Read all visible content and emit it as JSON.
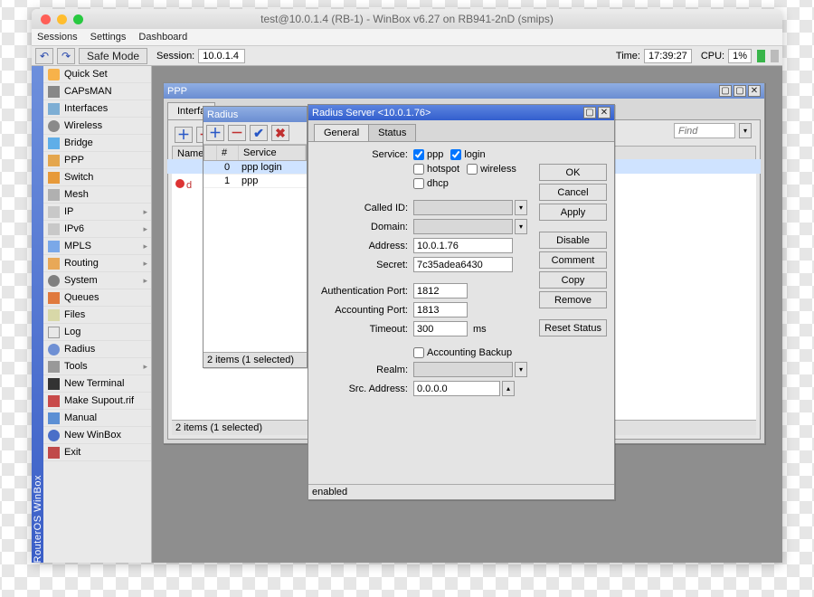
{
  "window_title": "test@10.0.1.4 (RB-1) - WinBox v6.27 on RB941-2nD (smips)",
  "menubar": {
    "sessions": "Sessions",
    "settings": "Settings",
    "dashboard": "Dashboard"
  },
  "toolbar": {
    "safe_mode": "Safe Mode",
    "session_label": "Session:",
    "session_value": "10.0.1.4",
    "time_label": "Time:",
    "time_value": "17:39:27",
    "cpu_label": "CPU:",
    "cpu_value": "1%"
  },
  "vstrip": "RouterOS WinBox",
  "nav": [
    {
      "label": "Quick Set",
      "cls": "ico-qs"
    },
    {
      "label": "CAPsMAN",
      "cls": "ico-cap"
    },
    {
      "label": "Interfaces",
      "cls": "ico-if"
    },
    {
      "label": "Wireless",
      "cls": "ico-wl"
    },
    {
      "label": "Bridge",
      "cls": "ico-br"
    },
    {
      "label": "PPP",
      "cls": "ico-ppp"
    },
    {
      "label": "Switch",
      "cls": "ico-sw"
    },
    {
      "label": "Mesh",
      "cls": "ico-mesh"
    },
    {
      "label": "IP",
      "cls": "ico-ip",
      "sub": true
    },
    {
      "label": "IPv6",
      "cls": "ico-ip",
      "sub": true
    },
    {
      "label": "MPLS",
      "cls": "ico-mpls",
      "sub": true
    },
    {
      "label": "Routing",
      "cls": "ico-rt",
      "sub": true
    },
    {
      "label": "System",
      "cls": "ico-sys",
      "sub": true
    },
    {
      "label": "Queues",
      "cls": "ico-q"
    },
    {
      "label": "Files",
      "cls": "ico-files"
    },
    {
      "label": "Log",
      "cls": "ico-log"
    },
    {
      "label": "Radius",
      "cls": "ico-rad"
    },
    {
      "label": "Tools",
      "cls": "ico-tools",
      "sub": true
    },
    {
      "label": "New Terminal",
      "cls": "ico-term"
    },
    {
      "label": "Make Supout.rif",
      "cls": "ico-sup"
    },
    {
      "label": "Manual",
      "cls": "ico-man"
    },
    {
      "label": "New WinBox",
      "cls": "ico-new"
    },
    {
      "label": "Exit",
      "cls": "ico-exit"
    }
  ],
  "ppp_window": {
    "title": "PPP",
    "tabs_first": "Interfa",
    "status": "2 items (1 selected)",
    "col_name": "Name",
    "find_placeholder": "Find"
  },
  "radius_window": {
    "title": "Radius",
    "cols": {
      "num": "#",
      "service": "Service"
    },
    "rows": [
      {
        "idx": "0",
        "service": "ppp login",
        "sel": true
      },
      {
        "idx": "1",
        "service": "ppp",
        "sel": false
      }
    ],
    "status": "2 items (1 selected)"
  },
  "radius_server": {
    "title": "Radius Server <10.0.1.76>",
    "tabs": {
      "general": "General",
      "status": "Status"
    },
    "labels": {
      "service": "Service:",
      "called_id": "Called ID:",
      "domain": "Domain:",
      "address": "Address:",
      "secret": "Secret:",
      "auth_port": "Authentication Port:",
      "acct_port": "Accounting Port:",
      "timeout": "Timeout:",
      "acct_backup": "Accounting Backup",
      "realm": "Realm:",
      "src_address": "Src. Address:",
      "ms": "ms"
    },
    "services": {
      "ppp": "ppp",
      "login": "login",
      "hotspot": "hotspot",
      "wireless": "wireless",
      "dhcp": "dhcp"
    },
    "values": {
      "ppp": true,
      "login": true,
      "hotspot": false,
      "wireless": false,
      "dhcp": false,
      "address": "10.0.1.76",
      "secret": "7c35adea6430",
      "auth_port": "1812",
      "acct_port": "1813",
      "timeout": "300",
      "acct_backup": false,
      "src_address": "0.0.0.0"
    },
    "buttons": {
      "ok": "OK",
      "cancel": "Cancel",
      "apply": "Apply",
      "disable": "Disable",
      "comment": "Comment",
      "copy": "Copy",
      "remove": "Remove",
      "reset": "Reset Status"
    },
    "status": "enabled"
  }
}
